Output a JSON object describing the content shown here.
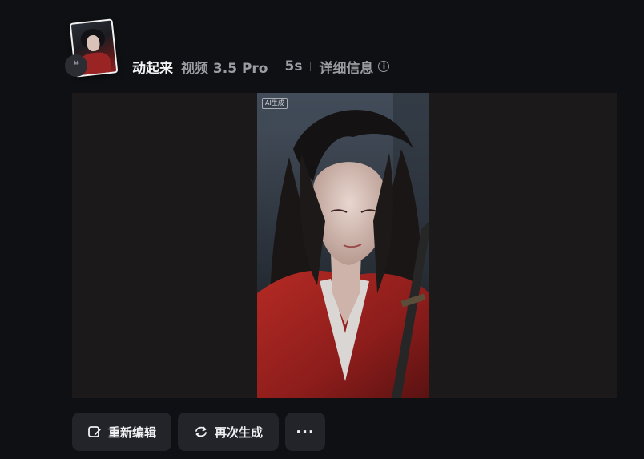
{
  "header": {
    "title": "动起来",
    "model": "视频 3.5 Pro",
    "duration": "5s",
    "details_label": "详细信息",
    "info_icon": "info-icon",
    "quote_badge": "❝"
  },
  "video": {
    "ai_tag": "AI生成"
  },
  "actions": {
    "edit_label": "重新编辑",
    "regenerate_label": "再次生成",
    "more_label": "···"
  },
  "colors": {
    "background": "#0f1013",
    "player_bg": "#1c191a",
    "button_bg": "#22242a",
    "muted_text": "#9a9ca3",
    "robe_red": "#9a2323"
  }
}
